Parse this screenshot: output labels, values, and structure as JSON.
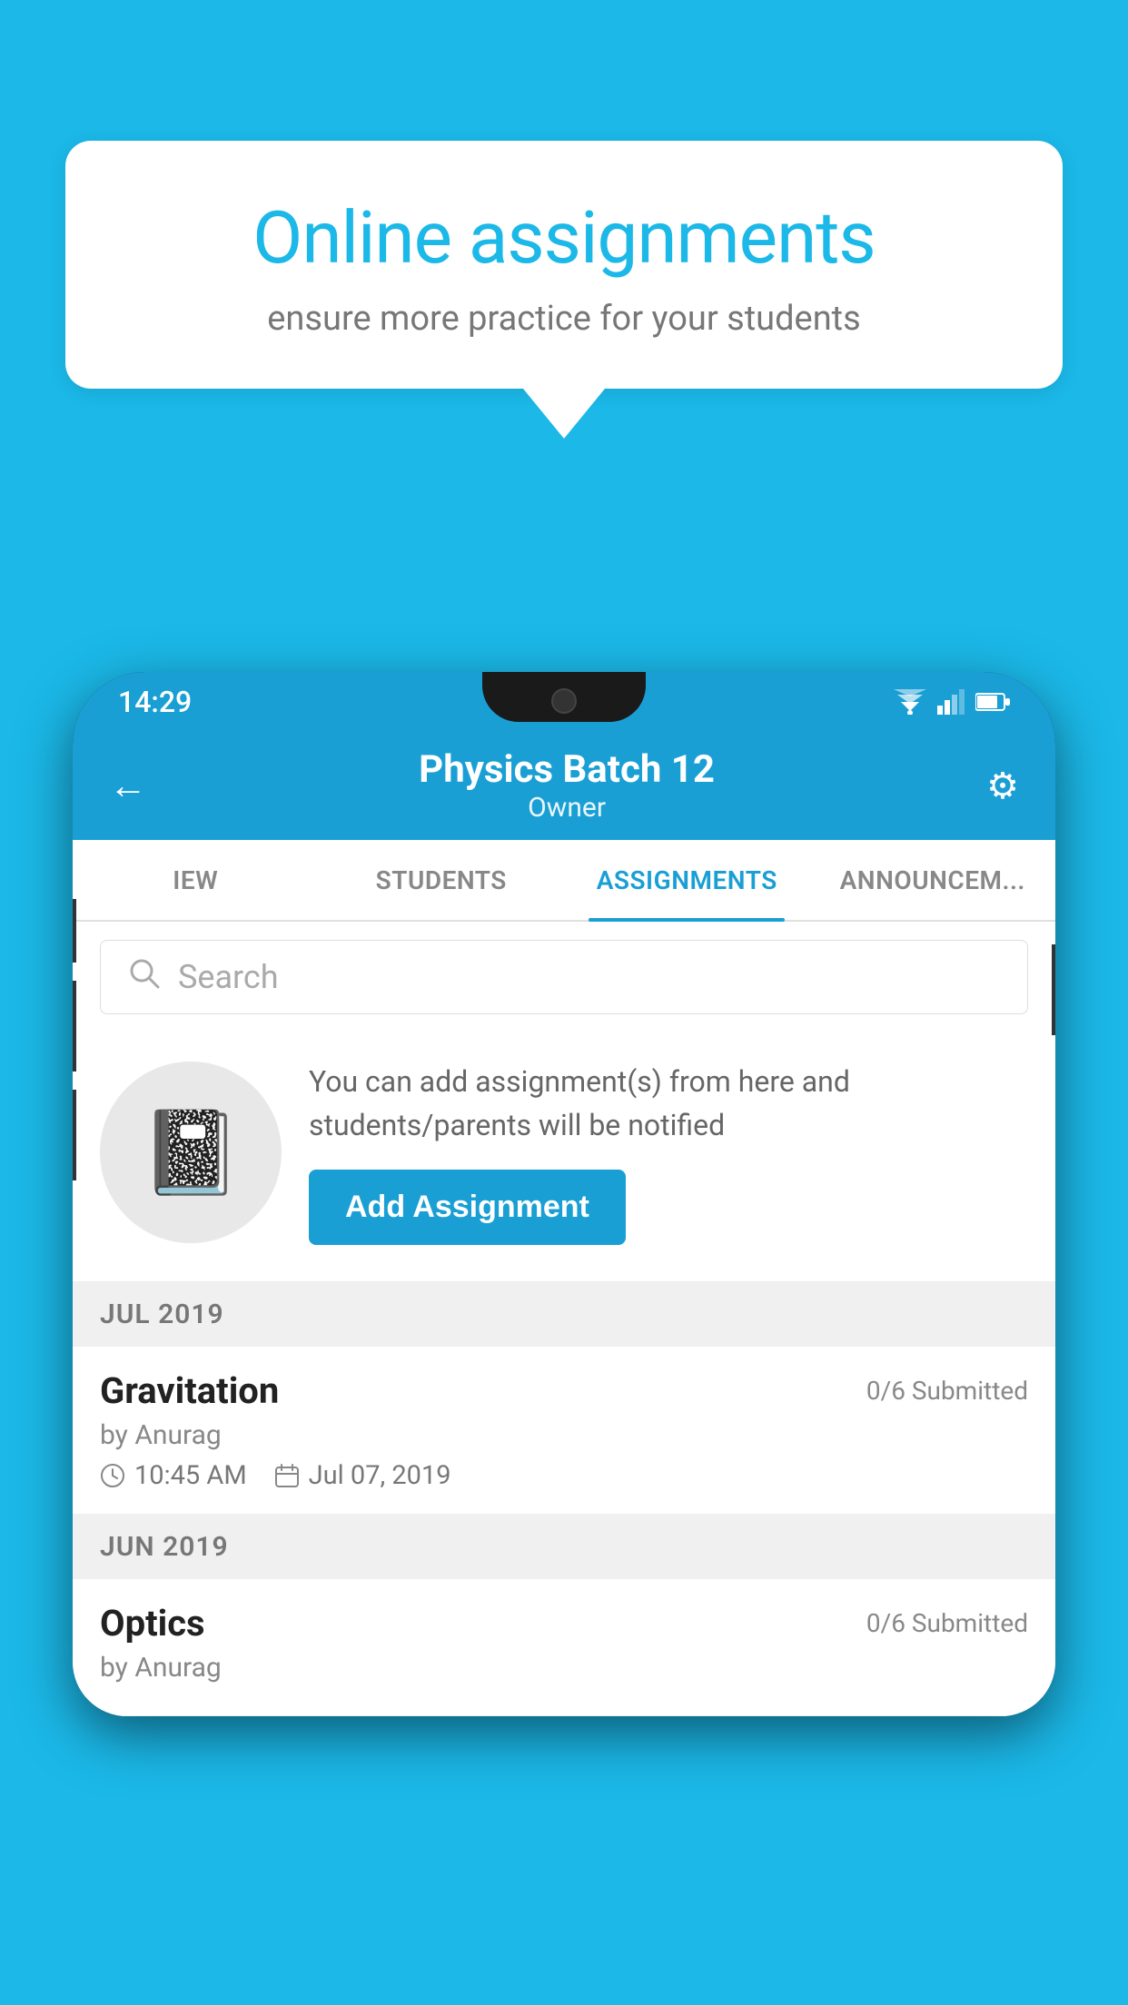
{
  "background_color": "#1BB8E8",
  "speech_bubble": {
    "title": "Online assignments",
    "subtitle": "ensure more practice for your students"
  },
  "phone": {
    "status_bar": {
      "time": "14:29"
    },
    "header": {
      "title": "Physics Batch 12",
      "subtitle": "Owner",
      "back_label": "←",
      "settings_label": "⚙"
    },
    "tabs": [
      {
        "label": "IEW",
        "active": false
      },
      {
        "label": "STUDENTS",
        "active": false
      },
      {
        "label": "ASSIGNMENTS",
        "active": true
      },
      {
        "label": "ANNOUNCEM...",
        "active": false
      }
    ],
    "search": {
      "placeholder": "Search"
    },
    "promo": {
      "description": "You can add assignment(s) from here and students/parents will be notified",
      "add_button_label": "Add Assignment"
    },
    "assignments": {
      "sections": [
        {
          "month_label": "JUL 2019",
          "items": [
            {
              "name": "Gravitation",
              "submitted": "0/6 Submitted",
              "by": "by Anurag",
              "time": "10:45 AM",
              "date": "Jul 07, 2019"
            }
          ]
        },
        {
          "month_label": "JUN 2019",
          "items": [
            {
              "name": "Optics",
              "submitted": "0/6 Submitted",
              "by": "by Anurag",
              "time": "",
              "date": ""
            }
          ]
        }
      ]
    }
  }
}
